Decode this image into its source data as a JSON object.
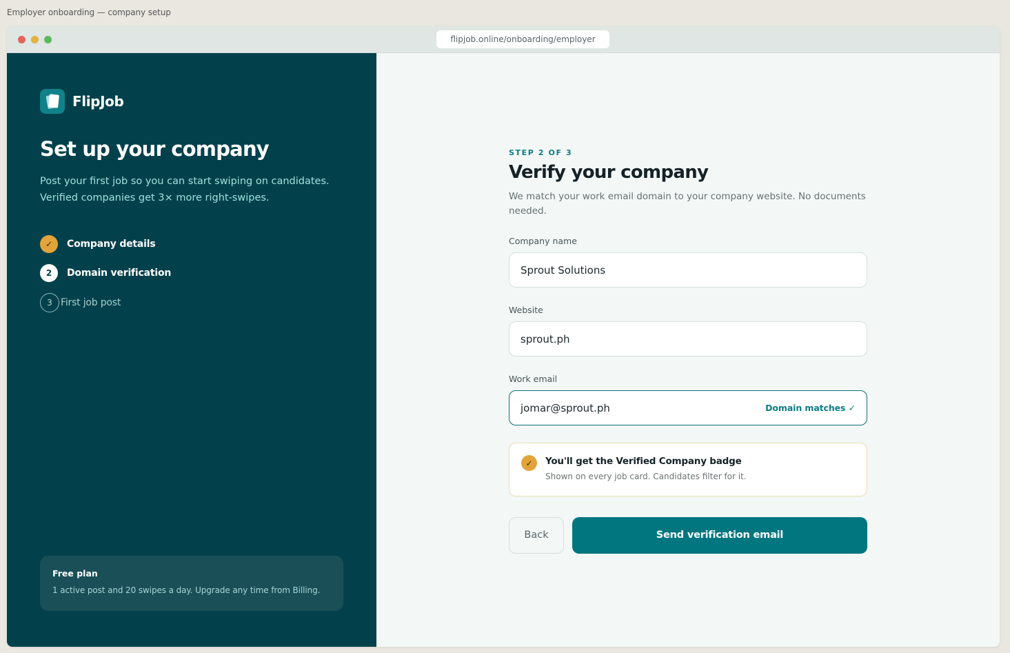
{
  "page_caption": "Employer onboarding — company setup",
  "browser": {
    "url": "flipjob.online/onboarding/employer"
  },
  "brand": {
    "name": "FlipJob"
  },
  "left_panel": {
    "title": "Set up your company",
    "subtitle_line1": "Post your first job so you can start swiping on candidates.",
    "subtitle_line2": "Verified companies get 3× more right-swipes.",
    "steps": [
      {
        "badge": "✓",
        "label": "Company details",
        "state": "done"
      },
      {
        "badge": "2",
        "label": "Domain verification",
        "state": "current"
      },
      {
        "badge": "3",
        "label": "First job post",
        "state": "upcoming"
      }
    ],
    "plan": {
      "title": "Free plan",
      "text": "1 active post and 20 swipes a day. Upgrade any time from Billing."
    }
  },
  "form": {
    "eyebrow": "STEP 2 OF 3",
    "title": "Verify your company",
    "description": "We match your work email domain to your company website. No documents needed.",
    "company_name": {
      "label": "Company name",
      "value": "Sprout Solutions"
    },
    "website": {
      "label": "Website",
      "value": "sprout.ph"
    },
    "work_email": {
      "label": "Work email",
      "value": "jomar@sprout.ph",
      "hint": "Domain matches ✓"
    },
    "badge_notice": {
      "check": "✓",
      "title": "You'll get the Verified Company badge",
      "subtitle": "Shown on every job card. Candidates filter for it."
    },
    "back_label": "Back",
    "submit_label": "Send verification email"
  },
  "colors": {
    "panel": "#02414b",
    "accent": "#02767f",
    "check_gold": "#e2a43a"
  }
}
